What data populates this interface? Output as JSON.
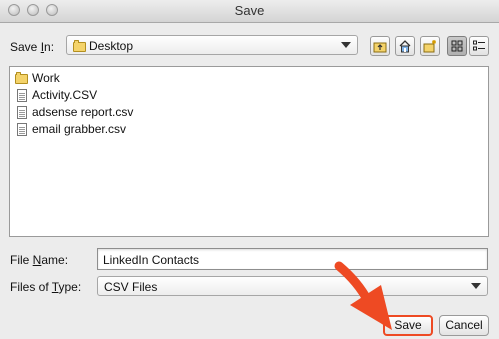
{
  "window": {
    "title": "Save"
  },
  "save_in": {
    "label_pre": "Save ",
    "label_ul": "I",
    "label_post": "n:",
    "value": "Desktop",
    "icon": "folder-icon"
  },
  "toolbar": {
    "buttons": [
      {
        "name": "up-one-level-icon"
      },
      {
        "name": "home-icon"
      },
      {
        "name": "new-folder-icon"
      },
      {
        "name": "list-view-icon"
      },
      {
        "name": "details-view-icon"
      }
    ]
  },
  "files": [
    {
      "name": "Work",
      "icon": "folder-icon"
    },
    {
      "name": "Activity.CSV",
      "icon": "file-icon"
    },
    {
      "name": "adsense report.csv",
      "icon": "file-icon"
    },
    {
      "name": "email grabber.csv",
      "icon": "file-icon"
    }
  ],
  "file_name": {
    "label_pre": "File ",
    "label_ul": "N",
    "label_post": "ame:",
    "value": "LinkedIn Contacts"
  },
  "file_type": {
    "label_pre": "Files of ",
    "label_ul": "T",
    "label_post": "ype:",
    "value": "CSV Files"
  },
  "buttons": {
    "save": "Save",
    "cancel": "Cancel"
  },
  "colors": {
    "arrow": "#ee4a23",
    "highlight": "#ee4a23"
  }
}
